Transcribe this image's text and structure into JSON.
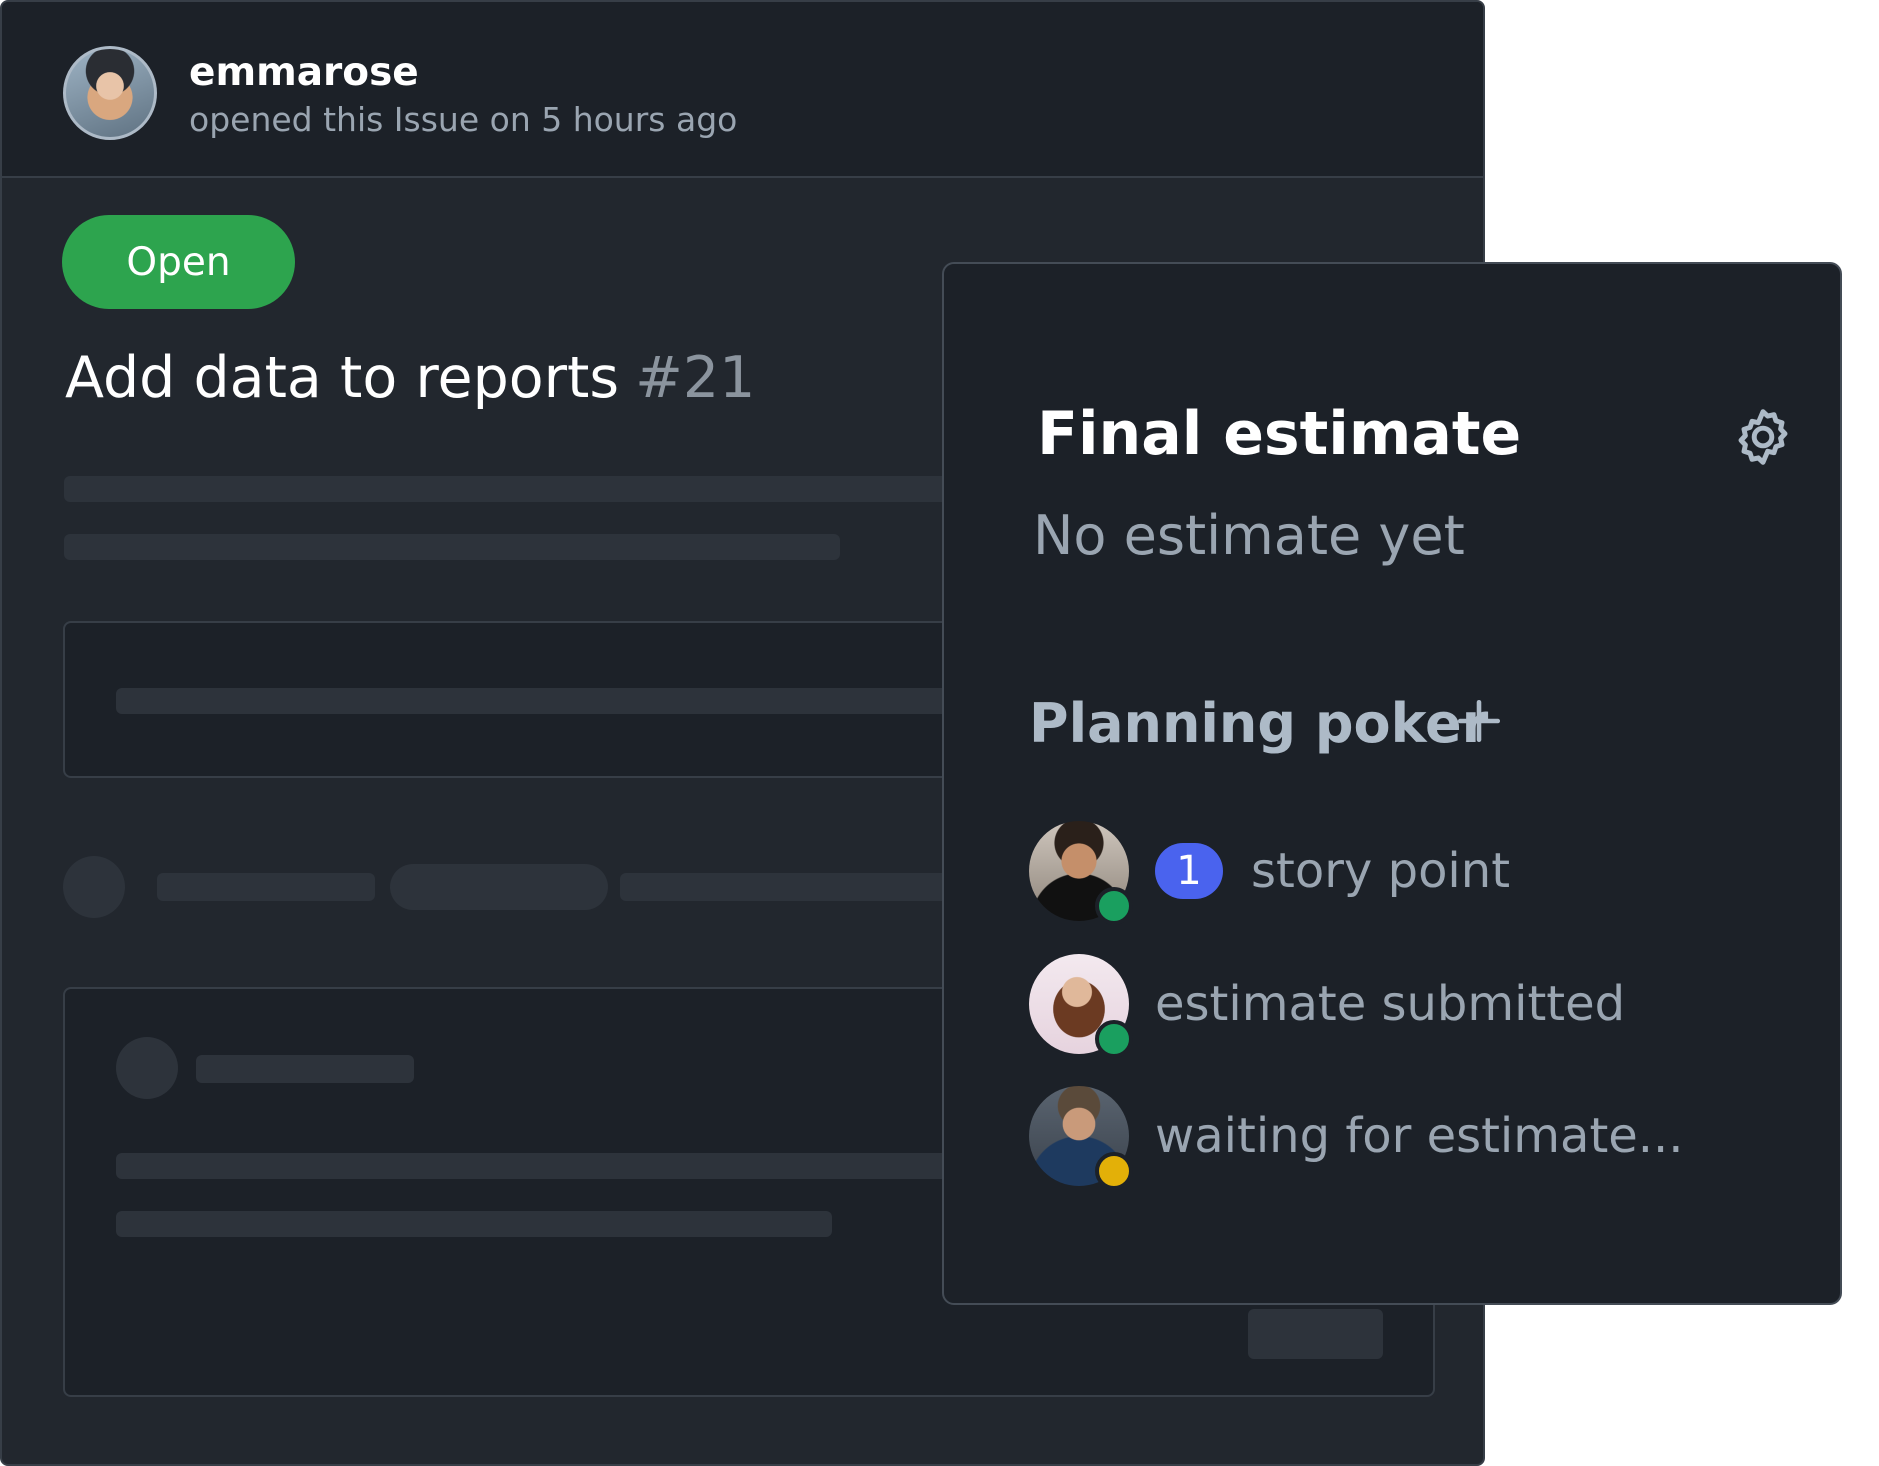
{
  "issue": {
    "author": "emmarose",
    "opened_text": "opened this Issue on 5 hours ago",
    "status": "Open",
    "title": "Add data to reports",
    "number": "#21"
  },
  "estimate_panel": {
    "title": "Final estimate",
    "settings_icon": "gear-icon",
    "value_text": "No estimate yet",
    "planning_label": "Planning poker",
    "add_icon": "plus-icon",
    "participants": [
      {
        "estimate": "1",
        "text": "story point",
        "status": "online",
        "status_color": "#1a9f5f"
      },
      {
        "estimate": "",
        "text": "estimate submitted",
        "status": "online",
        "status_color": "#1a9f5f"
      },
      {
        "estimate": "",
        "text": "waiting for estimate...",
        "status": "waiting",
        "status_color": "#e3b008"
      }
    ]
  },
  "colors": {
    "open_status": "#2da44e",
    "estimate_badge": "#4a63ee",
    "card_background": "#22272e",
    "panel_background": "#1c2128"
  }
}
